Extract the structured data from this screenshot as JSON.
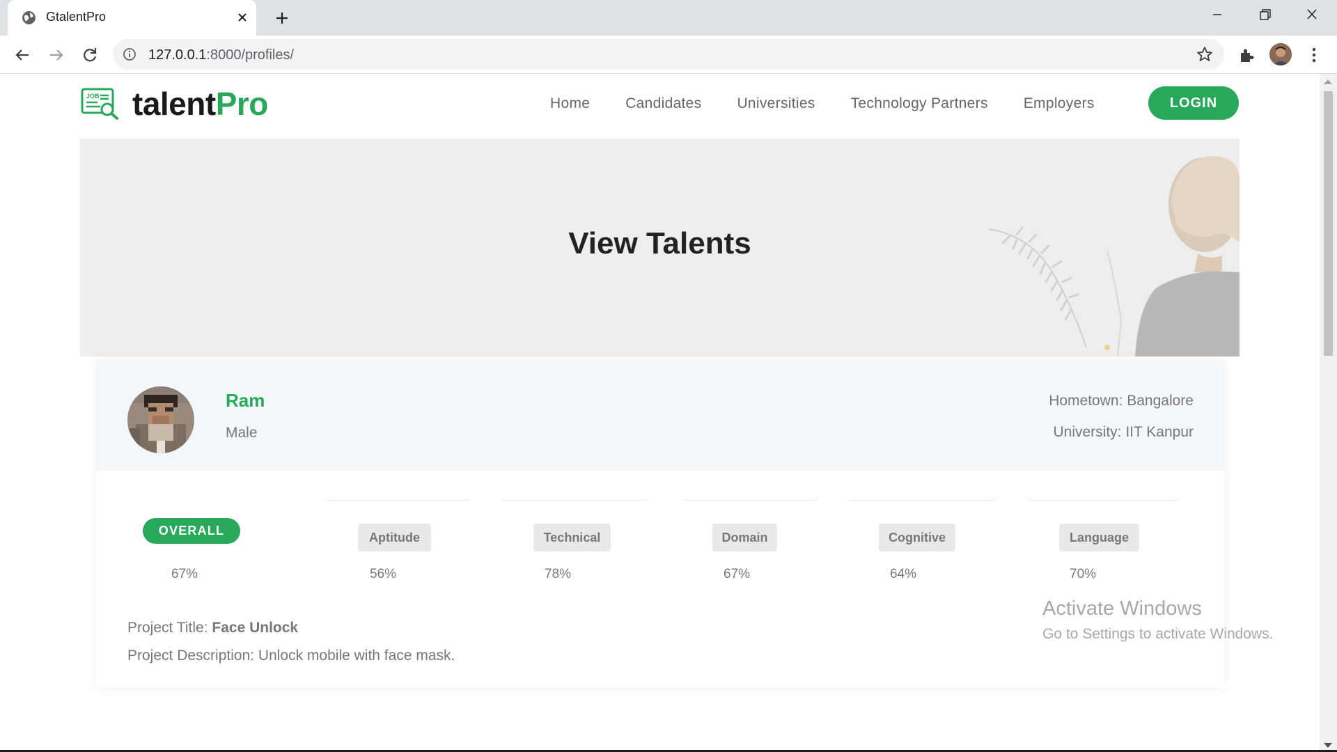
{
  "browser": {
    "tab_title": "GtalentPro",
    "url_host": "127.0.0.1",
    "url_rest": ":8000/profiles/"
  },
  "site": {
    "logo_main": "talent",
    "logo_accent": "Pro",
    "logo_icon_text": "JOB",
    "nav": [
      "Home",
      "Candidates",
      "Universities",
      "Technology Partners",
      "Employers"
    ],
    "login_label": "LOGIN",
    "accent_color": "#27a85a"
  },
  "hero": {
    "title": "View Talents"
  },
  "profile": {
    "name": "Ram",
    "gender": "Male",
    "hometown": "Hometown: Bangalore",
    "university": "University: IIT Kanpur",
    "overall_label": "OVERALL",
    "scores": [
      {
        "label": "OVERALL",
        "value": "67%"
      },
      {
        "label": "Aptitude",
        "value": "56%"
      },
      {
        "label": "Technical",
        "value": "78%"
      },
      {
        "label": "Domain",
        "value": "67%"
      },
      {
        "label": "Cognitive",
        "value": "64%"
      },
      {
        "label": "Language",
        "value": "70%"
      }
    ],
    "project_title_label": "Project Title: ",
    "project_title": "Face Unlock",
    "project_description": "Project Description: Unlock mobile with face mask."
  },
  "os": {
    "watermark_title": "Activate Windows",
    "watermark_sub": "Go to Settings to activate Windows."
  }
}
